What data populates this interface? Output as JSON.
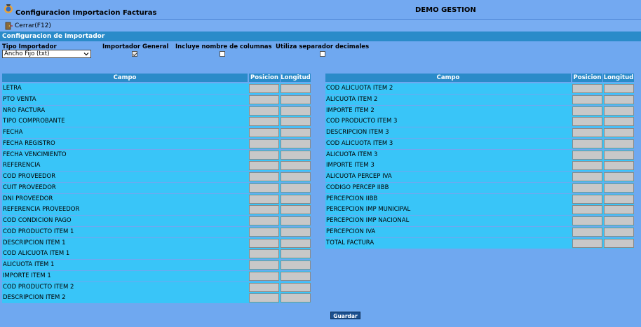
{
  "window": {
    "title": "Configuracion Importacion Facturas",
    "company": "DEMO GESTION"
  },
  "toolbar": {
    "close_label": "Cerrar(F12)"
  },
  "section": {
    "title": "Configuracion de Importador"
  },
  "options": {
    "tipo_label": "Tipo Importador",
    "tipo_value": "Ancho Fijo (txt)",
    "general_label": "Importador General",
    "general_checked": true,
    "columnas_label": "Incluye nombre de columnas",
    "columnas_checked": false,
    "separador_label": "Utiliza separador decimales",
    "separador_checked": false
  },
  "table_headers": {
    "campo": "Campo",
    "posicion": "Posicion",
    "longitud": "Longitud"
  },
  "left_fields": [
    "LETRA",
    "PTO VENTA",
    "NRO FACTURA",
    "TIPO COMPROBANTE",
    "FECHA",
    "FECHA REGISTRO",
    "FECHA VENCIMIENTO",
    "REFERENCIA",
    "COD PROVEEDOR",
    "CUIT PROVEEDOR",
    "DNI PROVEEDOR",
    "REFERENCIA PROVEEDOR",
    "COD CONDICION PAGO",
    "COD PRODUCTO ITEM 1",
    "DESCRIPCION ITEM 1",
    "COD ALICUOTA ITEM 1",
    "ALICUOTA ITEM 1",
    "IMPORTE ITEM 1",
    "COD PRODUCTO ITEM 2",
    "DESCRIPCION ITEM 2"
  ],
  "right_fields": [
    "COD ALICUOTA ITEM 2",
    "ALICUOTA ITEM 2",
    "IMPORTE ITEM 2",
    "COD PRODUCTO ITEM 3",
    "DESCRIPCION ITEM 3",
    "COD ALICUOTA ITEM 3",
    "ALICUOTA ITEM 3",
    "IMPORTE ITEM 3",
    "ALICUOTA PERCEP IVA",
    "CODIGO PERCEP IIBB",
    "PERCEPCION IIBB",
    "PERCEPCION IMP MUNICIPAL",
    "PERCEPCION IMP NACIONAL",
    "PERCEPCION IVA",
    "TOTAL FACTURA"
  ],
  "actions": {
    "save_label": "Guardar"
  },
  "colors": {
    "background": "#6fa8f0",
    "header": "#2a8bc9",
    "row": "#39c5f8",
    "input": "#c8c8c8"
  },
  "icons": {
    "app": "app-logo-icon",
    "close": "exit-door-icon",
    "dropdown": "chevron-down-icon"
  }
}
